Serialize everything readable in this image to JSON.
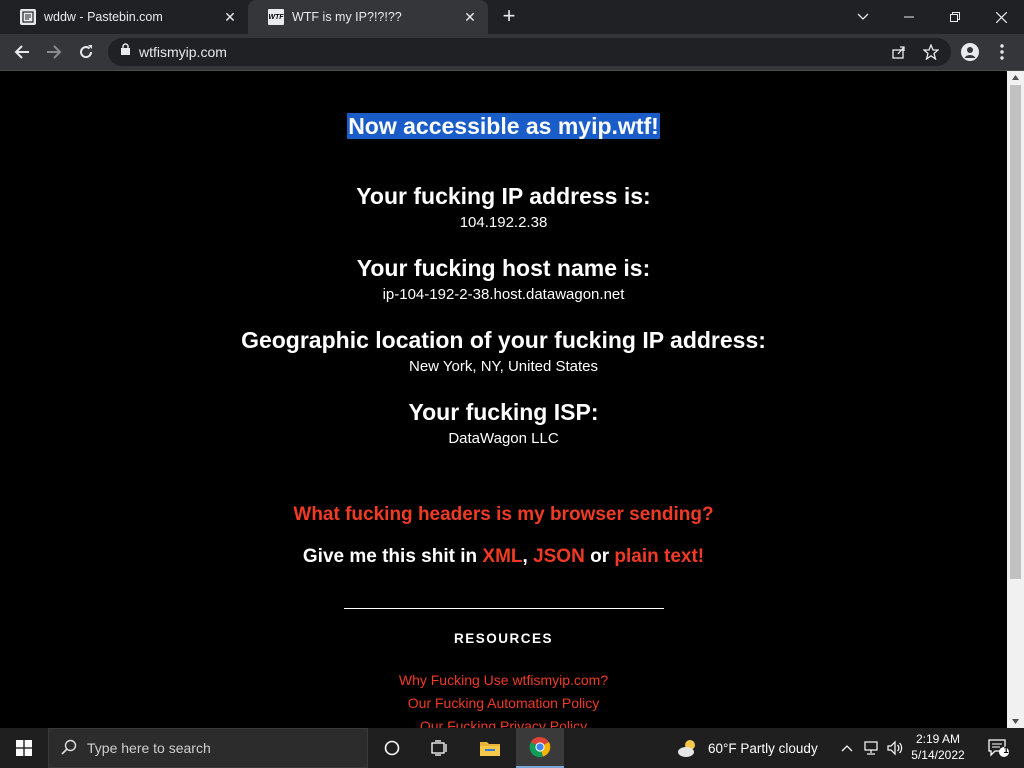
{
  "browser": {
    "tabs": [
      {
        "title": "wddw - Pastebin.com",
        "favicon": "pastebin-icon"
      },
      {
        "title": "WTF is my IP?!?!??",
        "favicon": "wtf-icon"
      }
    ],
    "favicon_text": {
      "wtf": "WTF"
    },
    "url": "wtfismyip.com"
  },
  "page": {
    "banner": "Now accessible as myip.wtf!",
    "sections": [
      {
        "heading": "Your fucking IP address is:",
        "value": "104.192.2.38"
      },
      {
        "heading": "Your fucking host name is:",
        "value": "ip-104-192-2-38.host.datawagon.net"
      },
      {
        "heading": "Geographic location of your fucking IP address:",
        "value": "New York, NY, United States"
      },
      {
        "heading": "Your fucking ISP:",
        "value": "DataWagon LLC"
      }
    ],
    "headers_link": "What fucking headers is my browser sending?",
    "give_me": {
      "prefix": "Give me this shit in ",
      "xml": "XML",
      "comma": ",",
      "json": "JSON",
      "or": " or ",
      "plain": "plain text!"
    },
    "resources_title": "RESOURCES",
    "resource_links": [
      "Why Fucking Use wtfismyip.com?",
      "Our Fucking Automation Policy",
      "Our Fucking Privacy Policy"
    ]
  },
  "taskbar": {
    "search_placeholder": "Type here to search",
    "weather": "60°F  Partly cloudy",
    "time": "2:19 AM",
    "date": "5/14/2022",
    "notification_count": "1"
  },
  "colors": {
    "link_red": "#f03a24",
    "banner_blue": "#1a5dc9",
    "background": "#000000"
  }
}
